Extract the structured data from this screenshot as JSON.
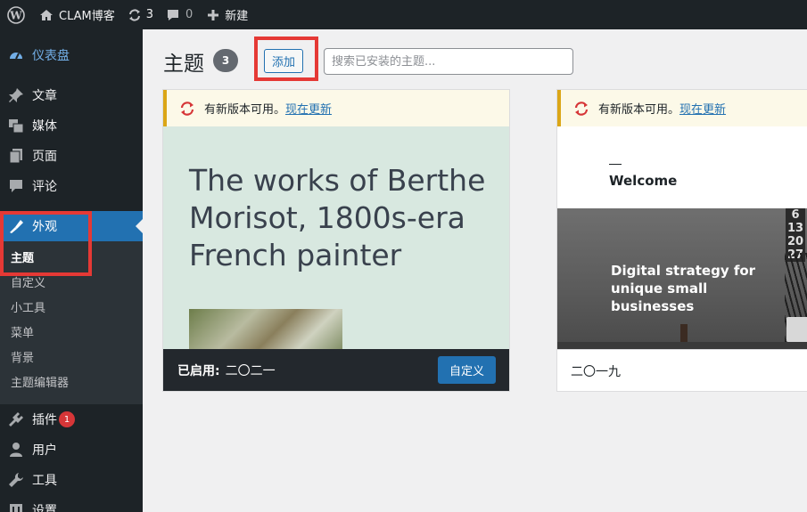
{
  "adminbar": {
    "site_name": "CLAM博客",
    "updates_count": "3",
    "comments_count": "0",
    "new_label": "新建"
  },
  "sidebar": {
    "items": [
      {
        "label": "仪表盘",
        "icon": "dashboard-icon"
      },
      {
        "label": "文章",
        "icon": "pin-icon"
      },
      {
        "label": "媒体",
        "icon": "media-icon"
      },
      {
        "label": "页面",
        "icon": "page-icon"
      },
      {
        "label": "评论",
        "icon": "comment-icon"
      },
      {
        "label": "外观",
        "icon": "appearance-icon"
      },
      {
        "label": "插件",
        "icon": "plugin-icon",
        "badge": "1"
      },
      {
        "label": "用户",
        "icon": "user-icon"
      },
      {
        "label": "工具",
        "icon": "wrench-icon"
      },
      {
        "label": "设置",
        "icon": "settings-icon"
      }
    ],
    "submenu": [
      "主题",
      "自定义",
      "小工具",
      "菜单",
      "背景",
      "主题编辑器"
    ]
  },
  "main": {
    "title": "主题",
    "count": "3",
    "add_label": "添加",
    "search_placeholder": "搜索已安装的主题..."
  },
  "themes": [
    {
      "notice_text": "有新版本可用。",
      "notice_link": "现在更新",
      "preview_heading": "The works of Berthe Morisot, 1800s-era French painter",
      "active_label": "已启用:",
      "name": "二〇二一",
      "customize_label": "自定义"
    },
    {
      "notice_text": "有新版本可用。",
      "notice_link": "现在更新",
      "preview_welcome": "Welcome",
      "preview_tagline": "Digital strategy for unique small businesses",
      "preview_calendar": "6 13 20 27",
      "name": "二〇一九"
    }
  ],
  "colors": {
    "admin_bg": "#1d2327",
    "accent": "#2271b1",
    "highlight_box": "#e53935",
    "notice_border": "#dba617"
  }
}
